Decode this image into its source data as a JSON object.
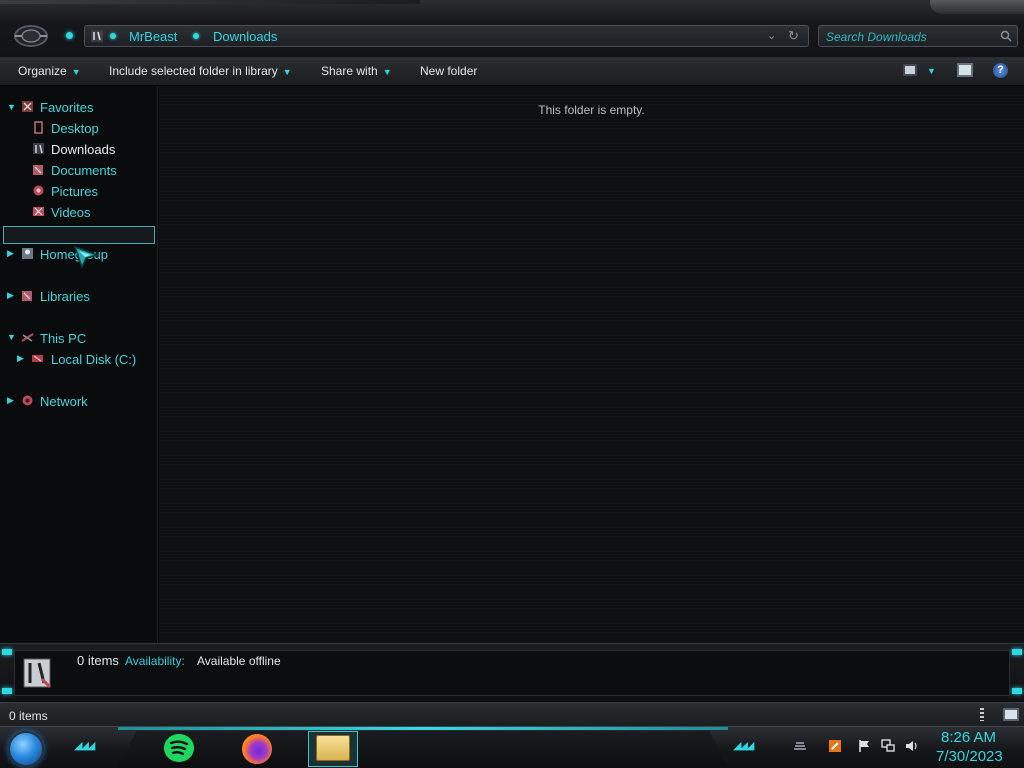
{
  "colors": {
    "accent": "#2fd7e0",
    "background": "#0b0c0e",
    "text": "#e2e6ea"
  },
  "address": {
    "crumbs": [
      "MrBeast",
      "Downloads"
    ],
    "search_placeholder": "Search Downloads"
  },
  "toolbar": {
    "organize": "Organize",
    "include_library": "Include selected folder in library",
    "share_with": "Share with",
    "new_folder": "New folder"
  },
  "nav": {
    "favorites": "Favorites",
    "favorites_items": [
      "Desktop",
      "Downloads",
      "Documents",
      "Pictures",
      "Videos"
    ],
    "selected": "Downloads",
    "homegroup": "Homegroup",
    "libraries": "Libraries",
    "this_pc": "This PC",
    "local_disk": "Local Disk (C:)",
    "network": "Network"
  },
  "content": {
    "empty_message": "This folder is empty."
  },
  "details": {
    "count": "0 items",
    "availability_label": "Availability:",
    "availability_value": "Available offline"
  },
  "status": {
    "count": "0 items"
  },
  "taskbar": {
    "pinned": [
      "spotify-icon",
      "firefox-icon",
      "file-explorer-icon"
    ],
    "active": "file-explorer-icon",
    "clock_time": "8:26 AM",
    "clock_date": "7/30/2023"
  }
}
